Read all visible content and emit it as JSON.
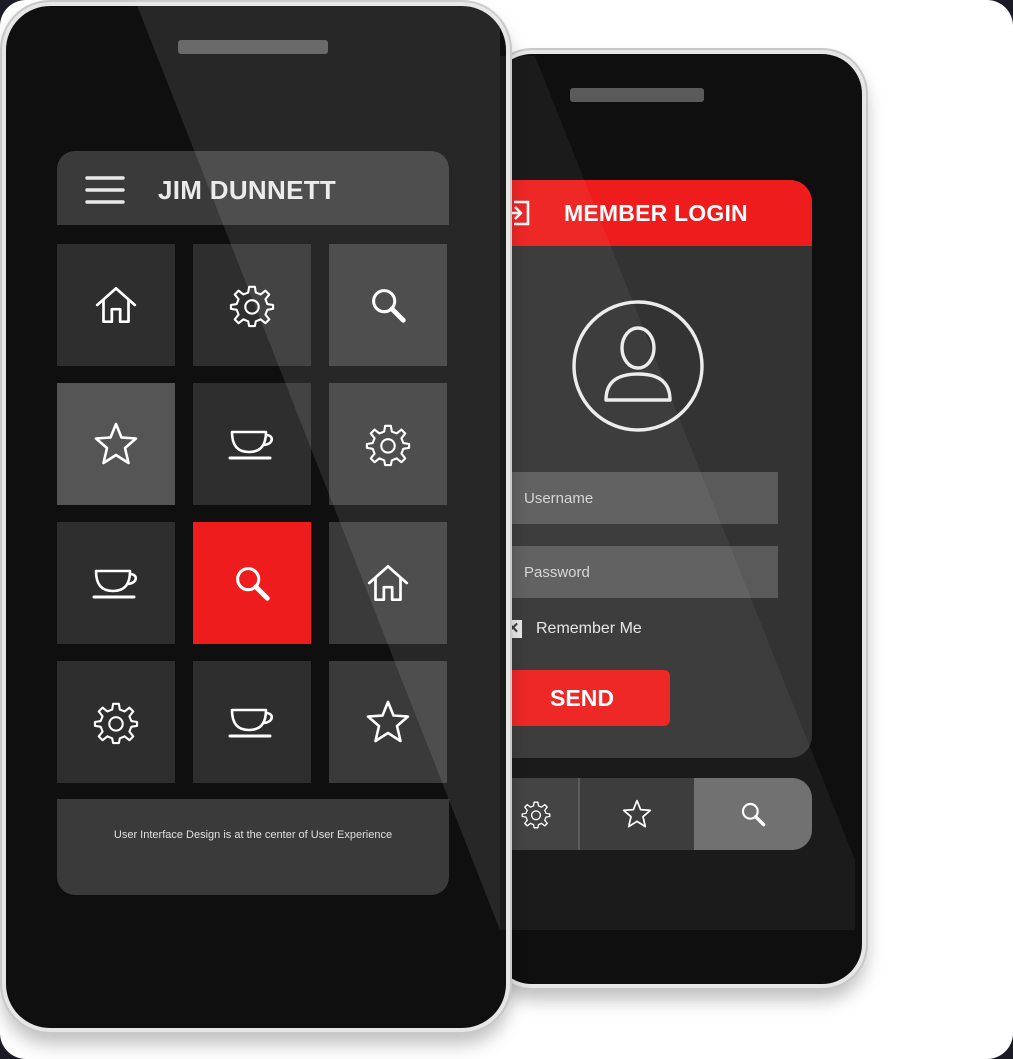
{
  "front_phone": {
    "header": {
      "title": "JIM DUNNETT",
      "menu_icon": "hamburger-menu-icon"
    },
    "tiles": [
      {
        "icon": "home-icon",
        "bg": "#2e2e2e"
      },
      {
        "icon": "gear-icon",
        "bg": "#2e2e2e"
      },
      {
        "icon": "search-icon",
        "bg": "#3a3a3a"
      },
      {
        "icon": "star-icon",
        "bg": "#555555"
      },
      {
        "icon": "coffee-cup-icon",
        "bg": "#2e2e2e"
      },
      {
        "icon": "gear-icon",
        "bg": "#3a3a3a"
      },
      {
        "icon": "coffee-cup-icon",
        "bg": "#2e2e2e"
      },
      {
        "icon": "search-icon",
        "bg": "#ee1c1c"
      },
      {
        "icon": "home-icon",
        "bg": "#3a3a3a"
      },
      {
        "icon": "gear-icon",
        "bg": "#2e2e2e"
      },
      {
        "icon": "coffee-cup-icon",
        "bg": "#2e2e2e"
      },
      {
        "icon": "star-icon",
        "bg": "#3a3a3a"
      }
    ],
    "footer": {
      "text": "User Interface Design is at the center of User Experience"
    }
  },
  "back_phone": {
    "login": {
      "title": "MEMBER LOGIN",
      "login_icon": "login-arrow-icon",
      "avatar_icon": "user-avatar-icon",
      "username_placeholder": "Username",
      "password_placeholder": "Password",
      "remember_label": "Remember Me",
      "remember_checked": true,
      "send_label": "SEND"
    },
    "bottom_bar": [
      {
        "icon": "gear-icon"
      },
      {
        "icon": "star-icon"
      },
      {
        "icon": "search-icon",
        "active": true
      }
    ]
  },
  "colors": {
    "accent": "#ee1c1c",
    "panel": "#333333",
    "phone_body": "#0f0f0f"
  }
}
